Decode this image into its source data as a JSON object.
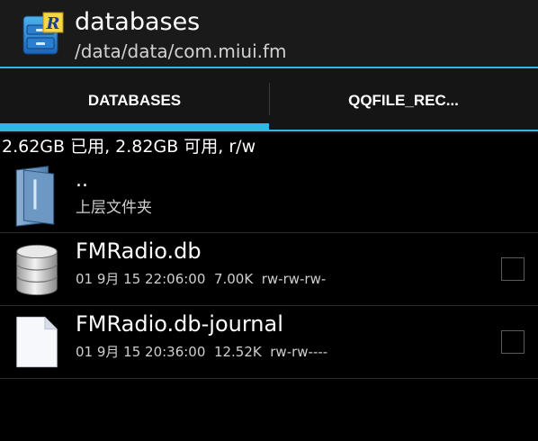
{
  "actionbar": {
    "title": "databases",
    "subtitle": "/data/data/com.miui.fm"
  },
  "tabs": [
    {
      "label": "DATABASES",
      "selected": true
    },
    {
      "label": "QQFILE_REC...",
      "selected": false
    }
  ],
  "storage_info": "2.62GB 已用, 2.82GB 可用, r/w",
  "parent_entry": {
    "name": "..",
    "label": "上层文件夹",
    "icon": "folder-up-icon"
  },
  "files": [
    {
      "name": "FMRadio.db",
      "date": "01 9月 15 22:06:00",
      "size": "7.00K",
      "perms": "rw-rw-rw-",
      "icon": "database-icon"
    },
    {
      "name": "FMRadio.db-journal",
      "date": "01 9月 15 20:36:00",
      "size": "12.52K",
      "perms": "rw-rw----",
      "icon": "document-icon"
    }
  ],
  "colors": {
    "accent": "#33b5e5",
    "background": "#000000",
    "actionbar": "#1a1a1a"
  }
}
